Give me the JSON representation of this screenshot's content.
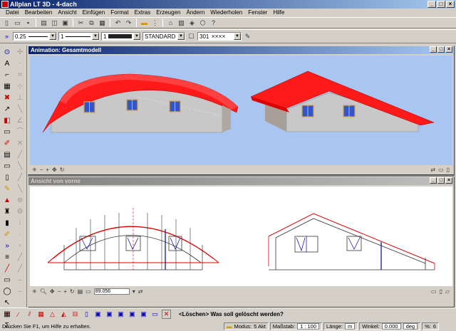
{
  "app": {
    "title": "Allplan LT 3D - 4-dach"
  },
  "menu": [
    "Datei",
    "Bearbeiten",
    "Ansicht",
    "Einfügen",
    "Format",
    "Extras",
    "Erzeugen",
    "Ändern",
    "Wiederholen",
    "Fenster",
    "Hilfe"
  ],
  "format_bar": {
    "pen_thickness": "0.25",
    "line_type": "1",
    "color_index": "1",
    "layer": "STANDARD",
    "hatch_number": "301"
  },
  "windows": {
    "animation": {
      "title": "Animation: Gesamtmodell"
    },
    "front_view": {
      "title": "Ansicht von vorne",
      "scale_value": "89.056"
    }
  },
  "prompt": {
    "text": "<Löschen> Was soll gelöscht werden?"
  },
  "status": {
    "help": "Drücken Sie F1, um Hilfe zu erhalten.",
    "mode_label": "Modus:",
    "mode_value": "5 Akt",
    "scale_label": "Maßstab:",
    "scale_value": "1 : 100",
    "length_label": "Länge:",
    "length_unit": "m",
    "angle_label": "Winkel:",
    "angle_value": "0.000",
    "angle_unit": "deg",
    "percent_label": "%:",
    "percent_value": "6"
  },
  "colors": {
    "roof": "#ff1a1a",
    "wall": "#c8c8c8",
    "sky": "#a9c6f2",
    "title_active": "#0a246a"
  }
}
